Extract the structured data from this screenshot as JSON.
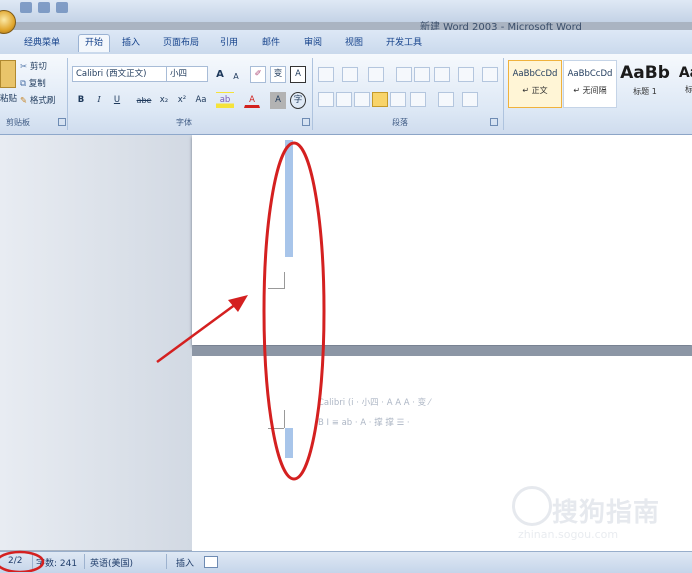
{
  "window": {
    "title": "新建 Word 2003 - Microsoft Word"
  },
  "tabs": [
    "经典菜单",
    "开始",
    "插入",
    "页面布局",
    "引用",
    "邮件",
    "审阅",
    "视图",
    "开发工具"
  ],
  "ribbon": {
    "clipboard": {
      "paste": "粘贴",
      "cut": "剪切",
      "copy": "复制",
      "format_painter": "格式刷",
      "label": "剪贴板"
    },
    "font": {
      "font_name": "Calibri (西文正文)",
      "font_size": "小四",
      "grow": "A",
      "shrink": "A",
      "phonetic": "变",
      "border_char": "A",
      "bold": "B",
      "italic": "I",
      "underline": "U",
      "strike": "abe",
      "subscript": "x₂",
      "superscript": "x²",
      "change_case": "Aa",
      "font_color": "A",
      "shading": "A",
      "enclose": "字",
      "label": "字体"
    },
    "paragraph": {
      "label": "段落"
    },
    "styles": [
      {
        "preview": "AaBbCcDd",
        "name": "正文"
      },
      {
        "preview": "AaBbCcDd",
        "name": "无间隔"
      },
      {
        "preview": "AaBb",
        "name": "标题 1"
      },
      {
        "preview": "Aa",
        "name": "标"
      }
    ]
  },
  "mini_toolbar": {
    "row1": "Calibri (i · 小四 · A A A · 变 ⁄",
    "row2": "B I ≡ ab · A · 撑 撑 ☰ ·"
  },
  "watermark": {
    "text": "搜狗指南",
    "url": "zhinan.sogou.com"
  },
  "statusbar": {
    "page": "2/2",
    "words": "字数: 241",
    "language": "英语(美国)",
    "mode": "插入"
  },
  "colors": {
    "annotation": "#d42020",
    "selection": "#a8c5ea",
    "accent": "#15428b"
  }
}
